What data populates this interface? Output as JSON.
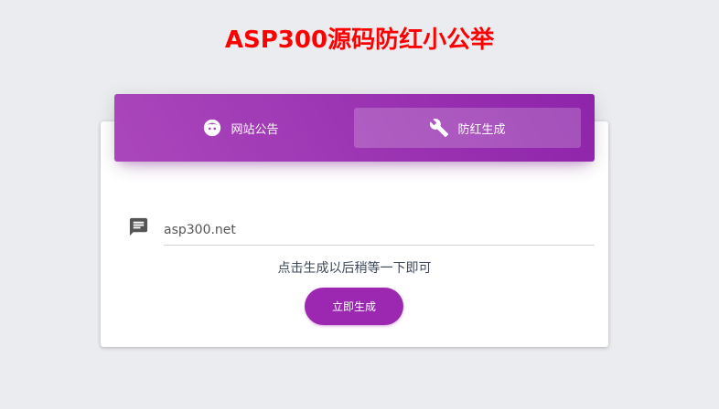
{
  "page": {
    "title": "ASP300源码防红小公举",
    "title_color": "#ff0000",
    "background": "#ebecf0"
  },
  "tabs": [
    {
      "label": "网站公告",
      "icon": "face-icon",
      "active": false
    },
    {
      "label": "防红生成",
      "icon": "wrench-icon",
      "active": true
    }
  ],
  "form": {
    "url_value": "asp300.net",
    "field_icon": "chat-icon",
    "hint": "点击生成以后稍等一下即可",
    "button_label": "立即生成"
  },
  "colors": {
    "accent": "#9c27b0",
    "header_gradient_start": "#ab47bc",
    "header_gradient_end": "#8e24aa"
  }
}
